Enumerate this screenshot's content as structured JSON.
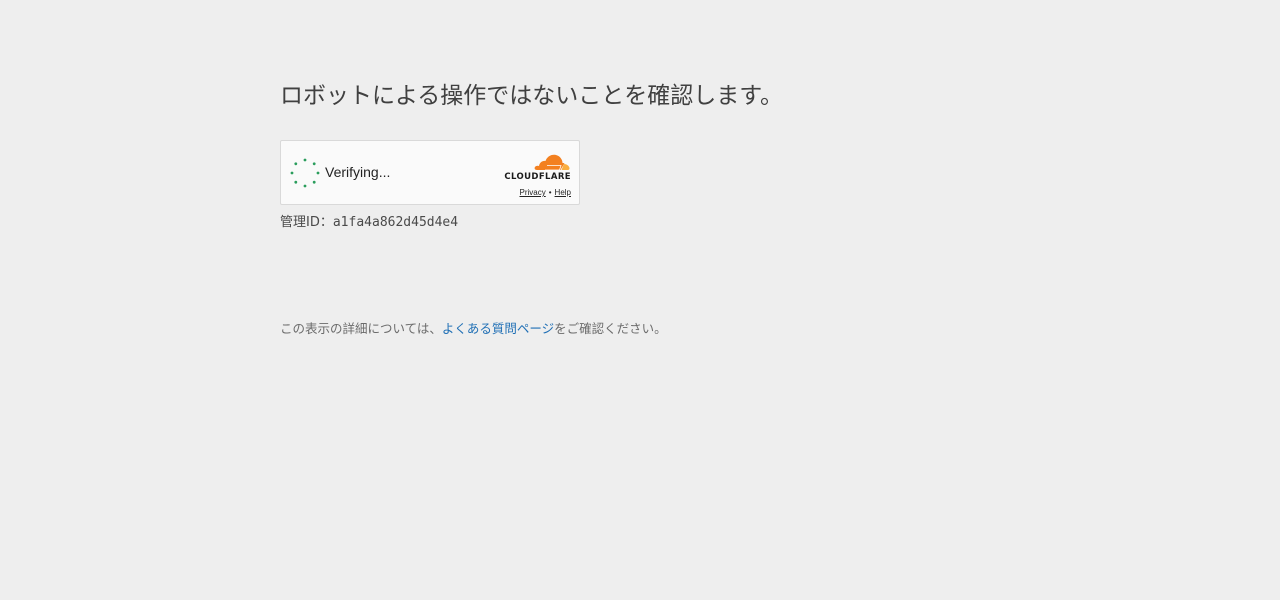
{
  "main": {
    "title": "ロボットによる操作ではないことを確認します。",
    "widget": {
      "status_text": "Verifying...",
      "brand_wordmark": "CLOUDFLARE",
      "privacy_link": "Privacy",
      "separator": "•",
      "help_link": "Help",
      "spinner_icon": "loading-spinner-icon",
      "brand_icon": "cloudflare-cloud-icon",
      "spinner_color": "#2a9d5c",
      "brand_orange": "#f38020",
      "brand_light_orange": "#faae40"
    },
    "ray_id": {
      "label": "管理ID：",
      "value": "a1fa4a862d45d4e4"
    }
  },
  "footer": {
    "text_before": "この表示の詳細については、",
    "link_text": "よくある質問ページ",
    "text_after": "をご確認ください。",
    "link_color": "#1f6fb5"
  }
}
